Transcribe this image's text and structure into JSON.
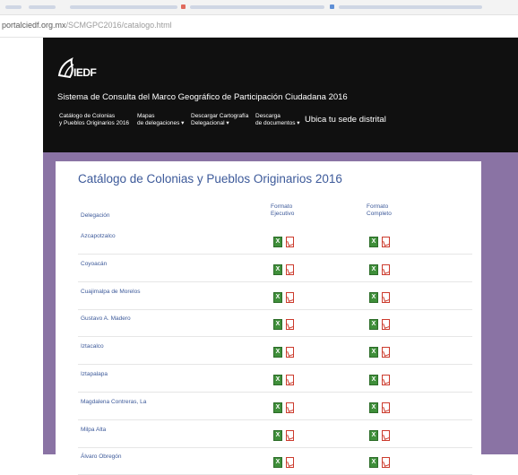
{
  "browser": {
    "url_host": "portalciedf.org.mx",
    "url_path": "/SCMGPC2016/catalogo.html"
  },
  "header": {
    "logo_text": "IEDF",
    "site_title": "Sistema de Consulta del Marco Geográfico de Participación Ciudadana 2016"
  },
  "nav": [
    {
      "line1": "Catálogo de Colonias",
      "line2": "y Pueblos Originarios 2016"
    },
    {
      "line1": "Mapas",
      "line2": "de delegaciones ▾"
    },
    {
      "line1": "Descargar Cartografía",
      "line2": "Delegacional ▾"
    },
    {
      "line1": "Descarga",
      "line2": "de documentos ▾"
    },
    {
      "line1": "Ubica tu sede distrital",
      "line2": ""
    }
  ],
  "catalog": {
    "title": "Catálogo de Colonias y Pueblos Originarios 2016",
    "col_delegacion": "Delegación",
    "col_ejecutivo_1": "Formato",
    "col_ejecutivo_2": "Ejecutivo",
    "col_completo_1": "Formato",
    "col_completo_2": "Completo",
    "rows": [
      "Azcapotzalco",
      "Coyoacán",
      "Cuajimalpa de Morelos",
      "Gustavo A. Madero",
      "Iztacalco",
      "Iztapalapa",
      "Magdalena Contreras, La",
      "Milpa Alta",
      "Álvaro Obregón"
    ]
  },
  "icons": {
    "excel": "excel-icon",
    "pdf": "pdf-icon"
  },
  "colors": {
    "purple_background": "#8a73a4",
    "header_background": "#101010",
    "link_blue": "#3d5a9a",
    "excel_green": "#3f8f3a",
    "pdf_red": "#cc3b2d"
  }
}
